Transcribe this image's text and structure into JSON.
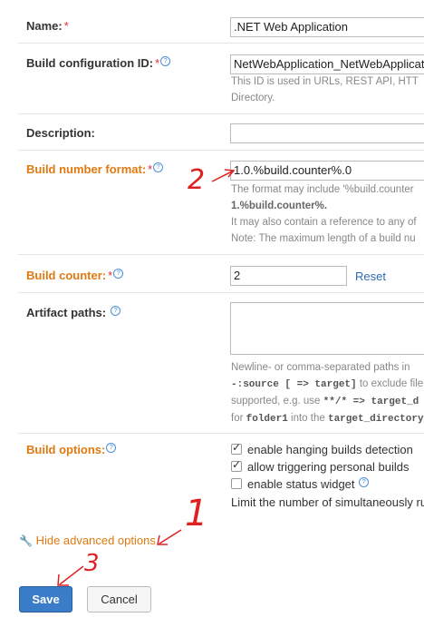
{
  "form": {
    "name": {
      "label": "Name:",
      "required": "*",
      "value": ".NET Web Application"
    },
    "build_config_id": {
      "label": "Build configuration ID:",
      "required": "*",
      "help": "?",
      "value": "NetWebApplication_NetWebApplicati",
      "note_line1": "This ID is used in URLs, REST API, HTT",
      "note_line2": "Directory."
    },
    "description": {
      "label": "Description:",
      "value": ""
    },
    "build_number_format": {
      "label": "Build number format:",
      "required": "*",
      "help": "?",
      "value": "1.0.%build.counter%.0",
      "note_line1": "The format may include '%build.counter",
      "note_line2": "1.%build.counter%.",
      "note_line3": "It may also contain a reference to any of",
      "note_line4": "Note: The maximum length of a build nu"
    },
    "build_counter": {
      "label": "Build counter:",
      "required": "*",
      "help": "?",
      "value": "2",
      "reset": "Reset"
    },
    "artifact_paths": {
      "label": "Artifact paths:",
      "help": "?",
      "note_line1": "Newline- or comma-separated paths in",
      "note_line2_code": "-:source [ => target]",
      "note_line2_text": " to exclude file",
      "note_line3_text": "supported, e.g. use ",
      "note_line3_code": "**/* => target_d",
      "note_line4_pre": "for ",
      "note_line4_code1": "folder1",
      "note_line4_mid": " into the ",
      "note_line4_code2": "target_directory"
    },
    "build_options": {
      "label": "Build options:",
      "help": "?",
      "options": [
        {
          "label": "enable hanging builds detection",
          "checked": true
        },
        {
          "label": "allow triggering personal builds",
          "checked": true
        },
        {
          "label": "enable status widget",
          "checked": false
        }
      ],
      "limit_text": "Limit the number of simultaneously ru"
    },
    "advanced_link": "Hide advanced options",
    "save": "Save",
    "cancel": "Cancel"
  },
  "annotations": {
    "one": "1",
    "two": "2",
    "three": "3"
  },
  "colors": {
    "orange_label": "#e07a10",
    "save_blue": "#3a7cc8",
    "annotation_red": "#e02020",
    "link_blue": "#2b6cb3"
  }
}
